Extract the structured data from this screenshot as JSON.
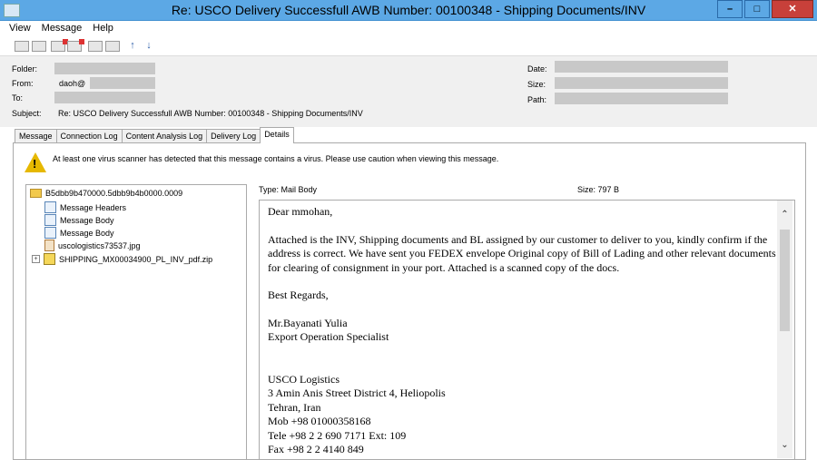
{
  "window": {
    "title": "Re: USCO Delivery Successfull AWB Number: 00100348 - Shipping Documents/INV"
  },
  "menu": [
    "View",
    "Message",
    "Help"
  ],
  "header": {
    "folder_label": "Folder:",
    "from_label": "From:",
    "from_value": "daoh@",
    "to_label": "To:",
    "subject_label": "Subject:",
    "subject_value": "Re: USCO Delivery Successfull AWB Number: 00100348 - Shipping Documents/INV",
    "date_label": "Date:",
    "size_label": "Size:",
    "path_label": "Path:"
  },
  "tabs": [
    "Message",
    "Connection Log",
    "Content Analysis Log",
    "Delivery Log",
    "Details"
  ],
  "warning": "At least one virus scanner has detected that this message contains a virus. Please use caution when viewing this message.",
  "tree": {
    "root": "B5dbb9b470000.5dbb9b4b0000.0009",
    "items": [
      "Message Headers",
      "Message Body",
      "Message Body",
      "uscologistics73537.jpg",
      "SHIPPING_MX00034900_PL_INV_pdf.zip"
    ]
  },
  "details": {
    "type": "Type:   Mail Body",
    "size": "Size:   797 B"
  },
  "body": {
    "greeting": "Dear mmohan,",
    "para": "Attached is the INV, Shipping documents and BL assigned by our customer to deliver to you, kindly confirm if the address is correct. We have sent you FEDEX envelope Original copy of Bill of Lading and other relevant documents for clearing of consignment in your port. Attached is a scanned copy of the docs.",
    "regards": "Best Regards,",
    "name": "Mr.Bayanati Yulia",
    "role": "Export Operation Specialist",
    "company": "USCO Logistics",
    "addr1": "3 Amin Anis Street District 4, Heliopolis",
    "addr2": "Tehran, Iran",
    "mob": "Mob +98 01000358168",
    "tele": "Tele +98 2 2 690 7171 Ext: 109",
    "fax": "Fax +98 2 2 4140 849"
  }
}
